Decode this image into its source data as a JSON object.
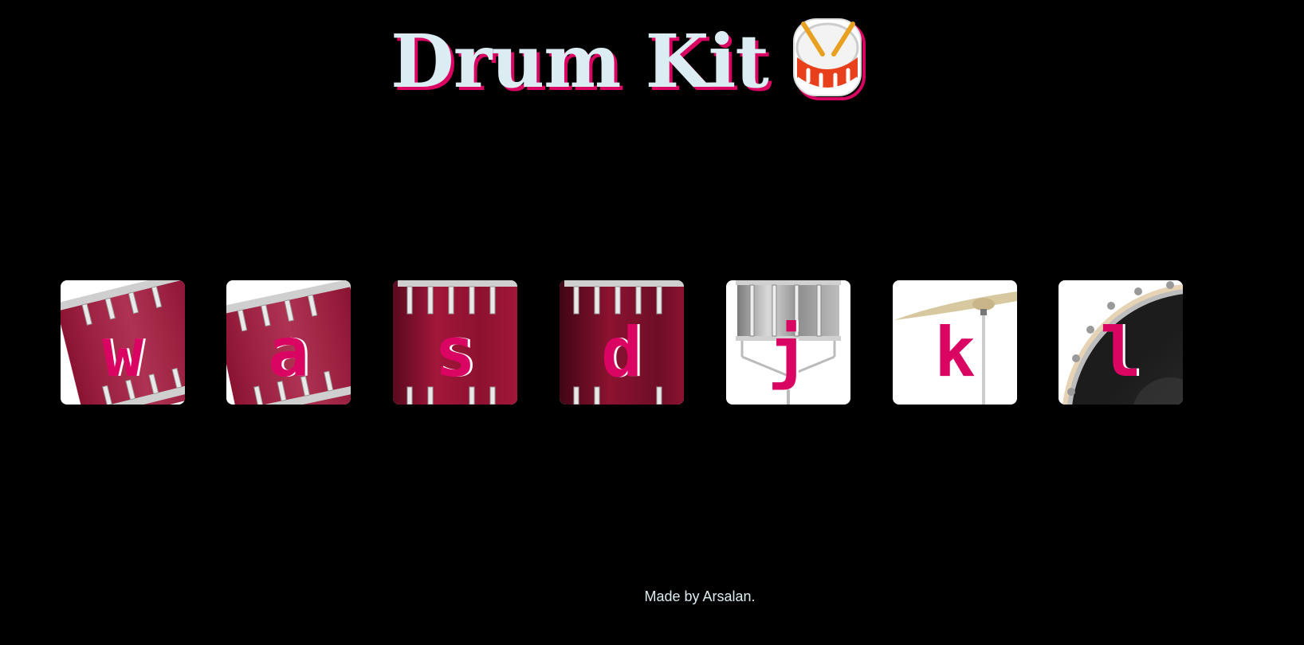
{
  "header": {
    "title": "Drum Kit",
    "emoji_icon": "drum-icon"
  },
  "drums": [
    {
      "key": "w",
      "instrument": "tom-1",
      "icon": "tom-drum-icon"
    },
    {
      "key": "a",
      "instrument": "tom-2",
      "icon": "tom-drum-icon"
    },
    {
      "key": "s",
      "instrument": "tom-3",
      "icon": "tom-drum-icon"
    },
    {
      "key": "d",
      "instrument": "tom-4",
      "icon": "tom-drum-icon"
    },
    {
      "key": "j",
      "instrument": "snare",
      "icon": "snare-drum-icon"
    },
    {
      "key": "k",
      "instrument": "crash",
      "icon": "cymbal-icon"
    },
    {
      "key": "l",
      "instrument": "kick-bass",
      "icon": "bass-drum-icon"
    }
  ],
  "footer": {
    "text": "Made by Arsalan."
  },
  "colors": {
    "background": "#000000",
    "title": "#DBEDF3",
    "accent": "#DA0463",
    "drum_red": "#A3163A",
    "drum_dark_red": "#6E0E26",
    "snare_gray": "#A9A9A9",
    "cymbal_gold": "#D8C8A0",
    "bass_black": "#2B2B2B"
  }
}
